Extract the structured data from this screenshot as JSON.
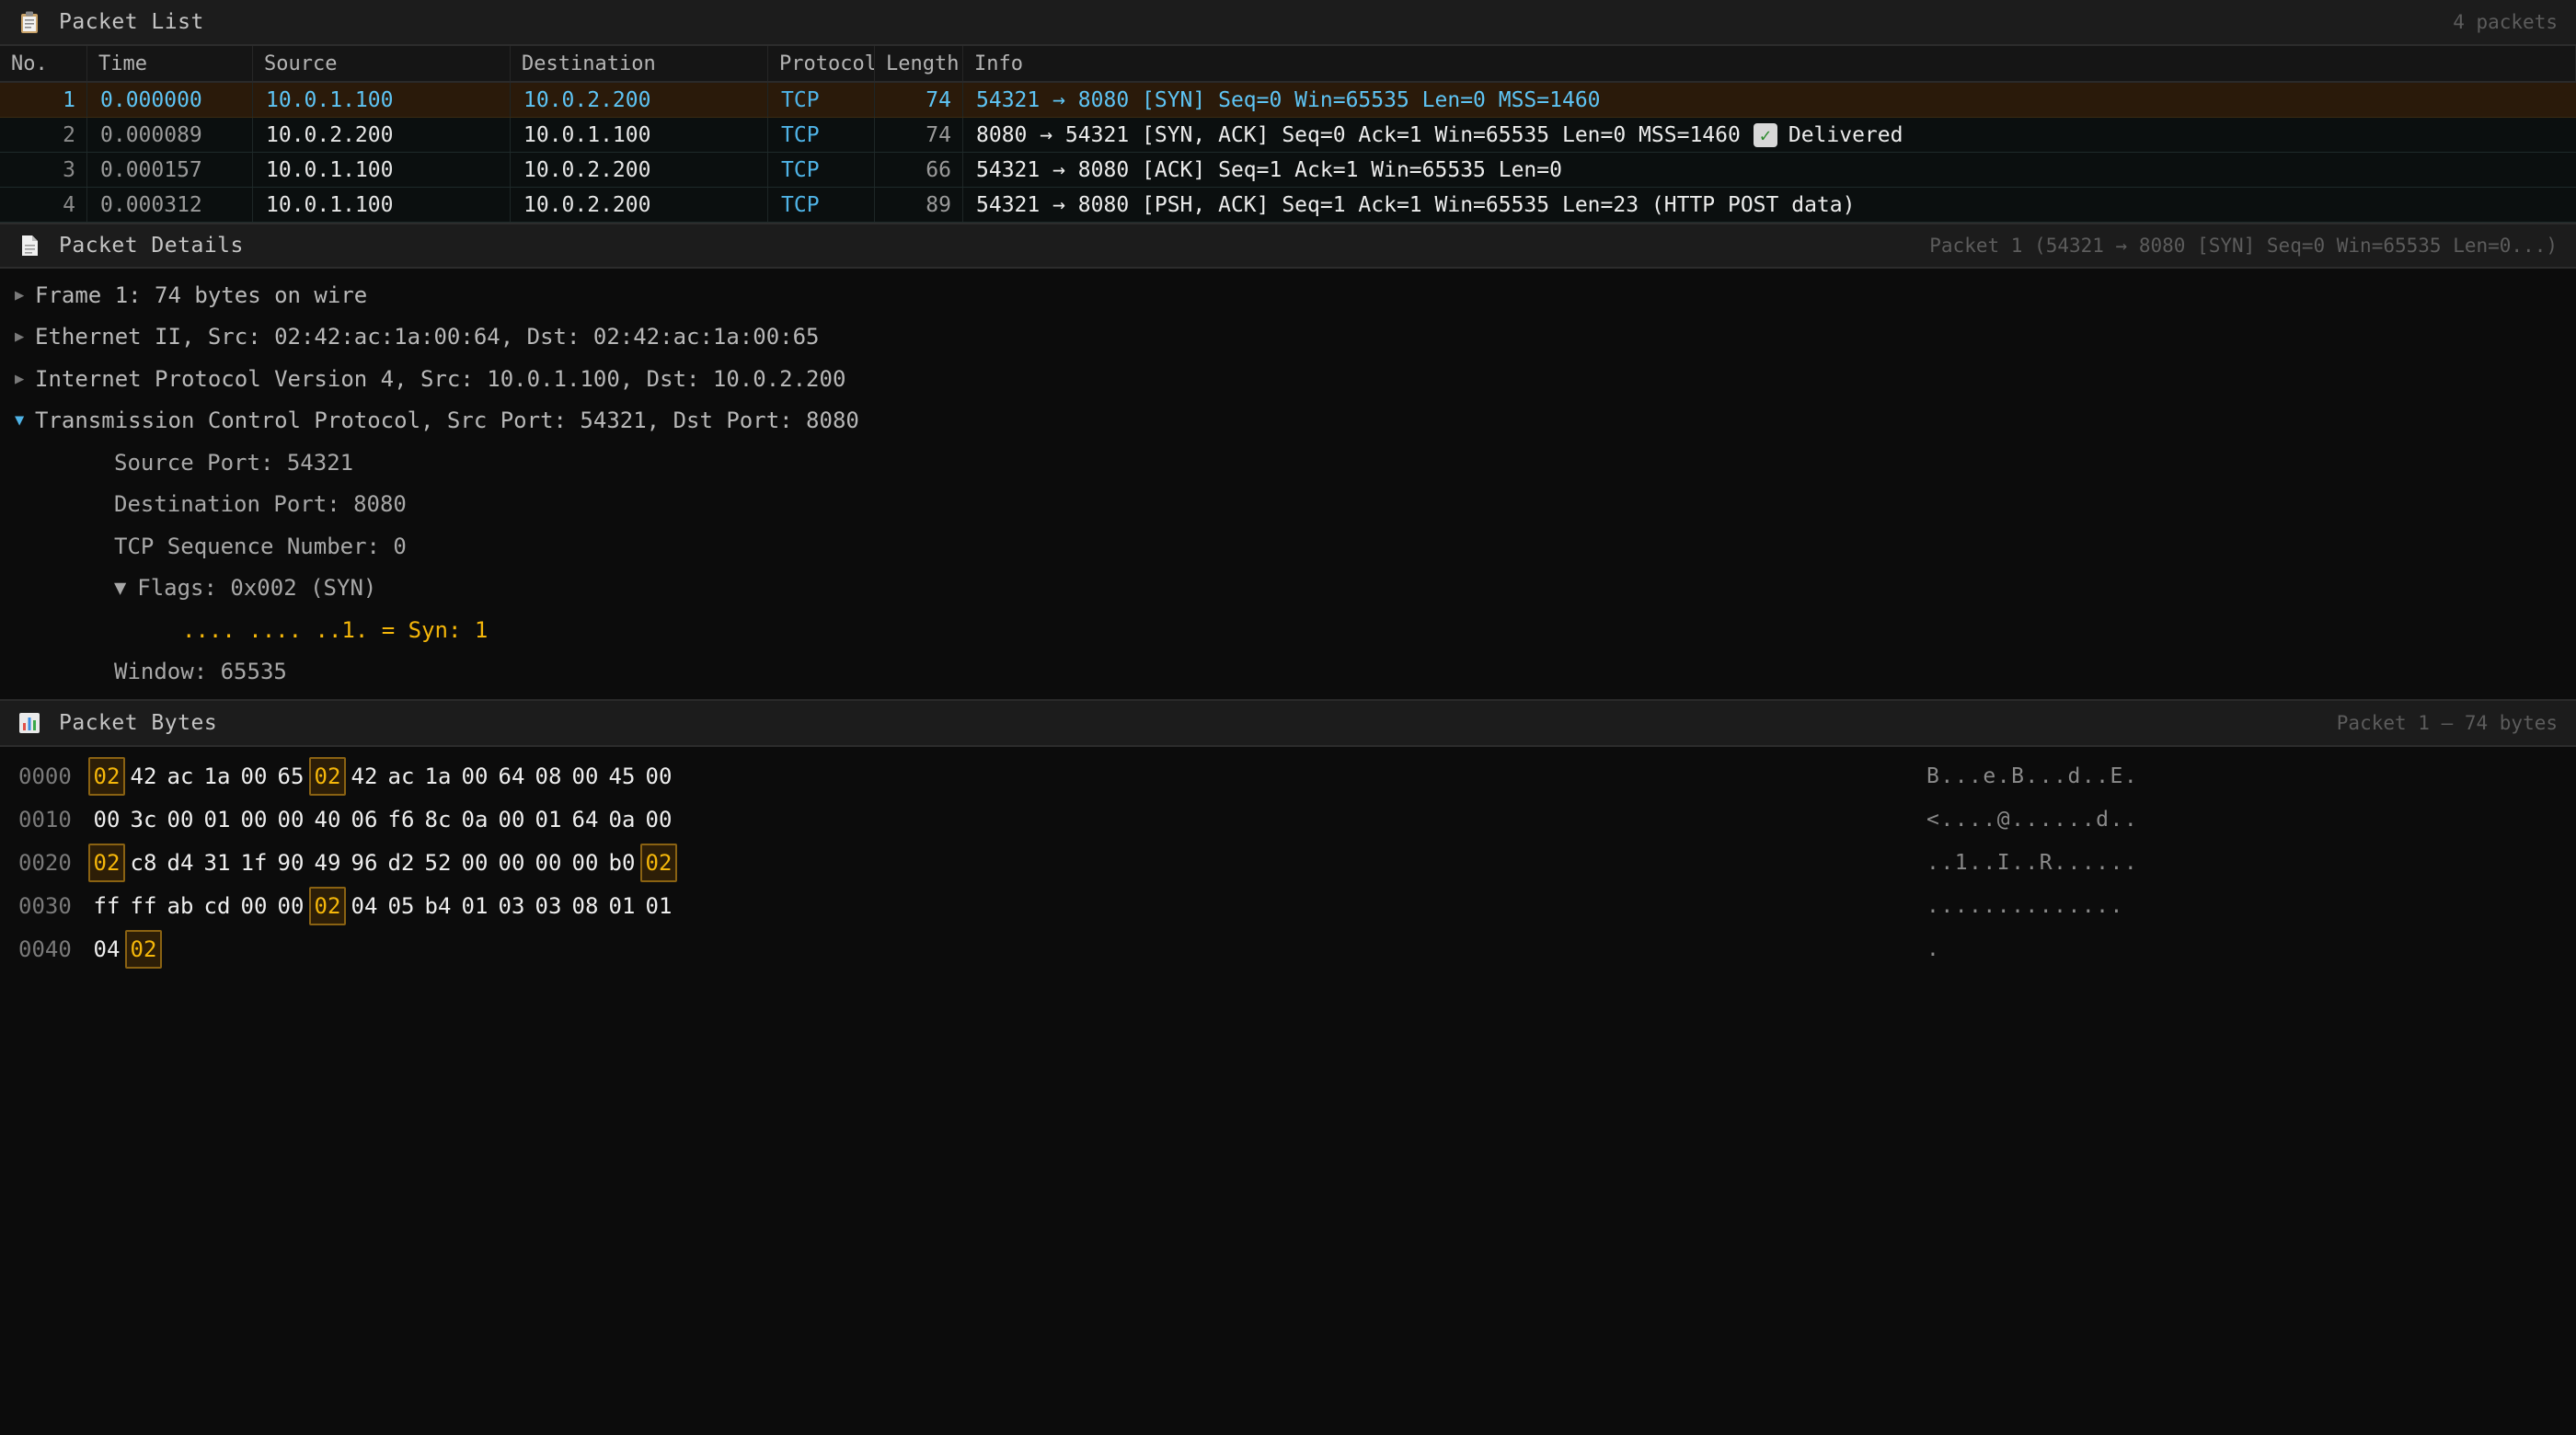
{
  "packet_list": {
    "title": "Packet List",
    "status": "4 packets",
    "columns": [
      "No.",
      "Time",
      "Source",
      "Destination",
      "Protocol",
      "Length",
      "Info"
    ],
    "rows": [
      {
        "no": "1",
        "time": "0.000000",
        "src": "10.0.1.100",
        "dst": "10.0.2.200",
        "proto": "TCP",
        "len": "74",
        "info": "54321 → 8080 [SYN] Seq=0 Win=65535 Len=0 MSS=1460",
        "badge": "",
        "selected": true
      },
      {
        "no": "2",
        "time": "0.000089",
        "src": "10.0.2.200",
        "dst": "10.0.1.100",
        "proto": "TCP",
        "len": "74",
        "info": "8080 → 54321 [SYN, ACK] Seq=0 Ack=1 Win=65535 Len=0 MSS=1460",
        "badge": "Delivered",
        "selected": false
      },
      {
        "no": "3",
        "time": "0.000157",
        "src": "10.0.1.100",
        "dst": "10.0.2.200",
        "proto": "TCP",
        "len": "66",
        "info": "54321 → 8080 [ACK] Seq=1 Ack=1 Win=65535 Len=0",
        "badge": "",
        "selected": false
      },
      {
        "no": "4",
        "time": "0.000312",
        "src": "10.0.1.100",
        "dst": "10.0.2.200",
        "proto": "TCP",
        "len": "89",
        "info": "54321 → 8080 [PSH, ACK] Seq=1 Ack=1 Win=65535 Len=23 (HTTP POST data)",
        "badge": "",
        "selected": false
      }
    ]
  },
  "packet_details": {
    "title": "Packet Details",
    "status": "Packet 1 (54321 → 8080 [SYN] Seq=0 Win=65535 Len=0...)",
    "frame": "Frame 1: 74 bytes on wire",
    "ethernet": "Ethernet II, Src: 02:42:ac:1a:00:64, Dst: 02:42:ac:1a:00:65",
    "ip": "Internet Protocol Version 4, Src: 10.0.1.100, Dst: 10.0.2.200",
    "tcp": "Transmission Control Protocol, Src Port: 54321, Dst Port: 8080",
    "src_port": "Source Port: 54321",
    "dst_port": "Destination Port: 8080",
    "seq": "TCP Sequence Number: 0",
    "flags": "Flags: 0x002 (SYN)",
    "syn": ".... .... ..1. = Syn: 1",
    "window": "Window: 65535"
  },
  "packet_bytes": {
    "title": "Packet Bytes",
    "status": "Packet 1 — 74 bytes",
    "highlight": "02",
    "rows": [
      {
        "offset": "0000",
        "bytes": [
          "02",
          "42",
          "ac",
          "1a",
          "00",
          "65",
          "02",
          "42",
          "ac",
          "1a",
          "00",
          "64",
          "08",
          "00",
          "45",
          "00"
        ],
        "ascii": "B...e.B...d..E."
      },
      {
        "offset": "0010",
        "bytes": [
          "00",
          "3c",
          "00",
          "01",
          "00",
          "00",
          "40",
          "06",
          "f6",
          "8c",
          "0a",
          "00",
          "01",
          "64",
          "0a",
          "00"
        ],
        "ascii": "<....@......d.."
      },
      {
        "offset": "0020",
        "bytes": [
          "02",
          "c8",
          "d4",
          "31",
          "1f",
          "90",
          "49",
          "96",
          "d2",
          "52",
          "00",
          "00",
          "00",
          "00",
          "b0",
          "02"
        ],
        "ascii": "..1..I..R......"
      },
      {
        "offset": "0030",
        "bytes": [
          "ff",
          "ff",
          "ab",
          "cd",
          "00",
          "00",
          "02",
          "04",
          "05",
          "b4",
          "01",
          "03",
          "03",
          "08",
          "01",
          "01"
        ],
        "ascii": ".............."
      },
      {
        "offset": "0040",
        "bytes": [
          "04",
          "02"
        ],
        "ascii": "."
      }
    ]
  },
  "colors": {
    "accent": "#4fb3e6",
    "highlight": "#f5b70a",
    "selected_row": "#2a1a0a",
    "background": "#0c0c0c"
  },
  "icons": {
    "packet_list": "clipboard-icon",
    "packet_details": "document-icon",
    "packet_bytes": "bar-chart-icon",
    "badge": "check-mark-icon"
  }
}
